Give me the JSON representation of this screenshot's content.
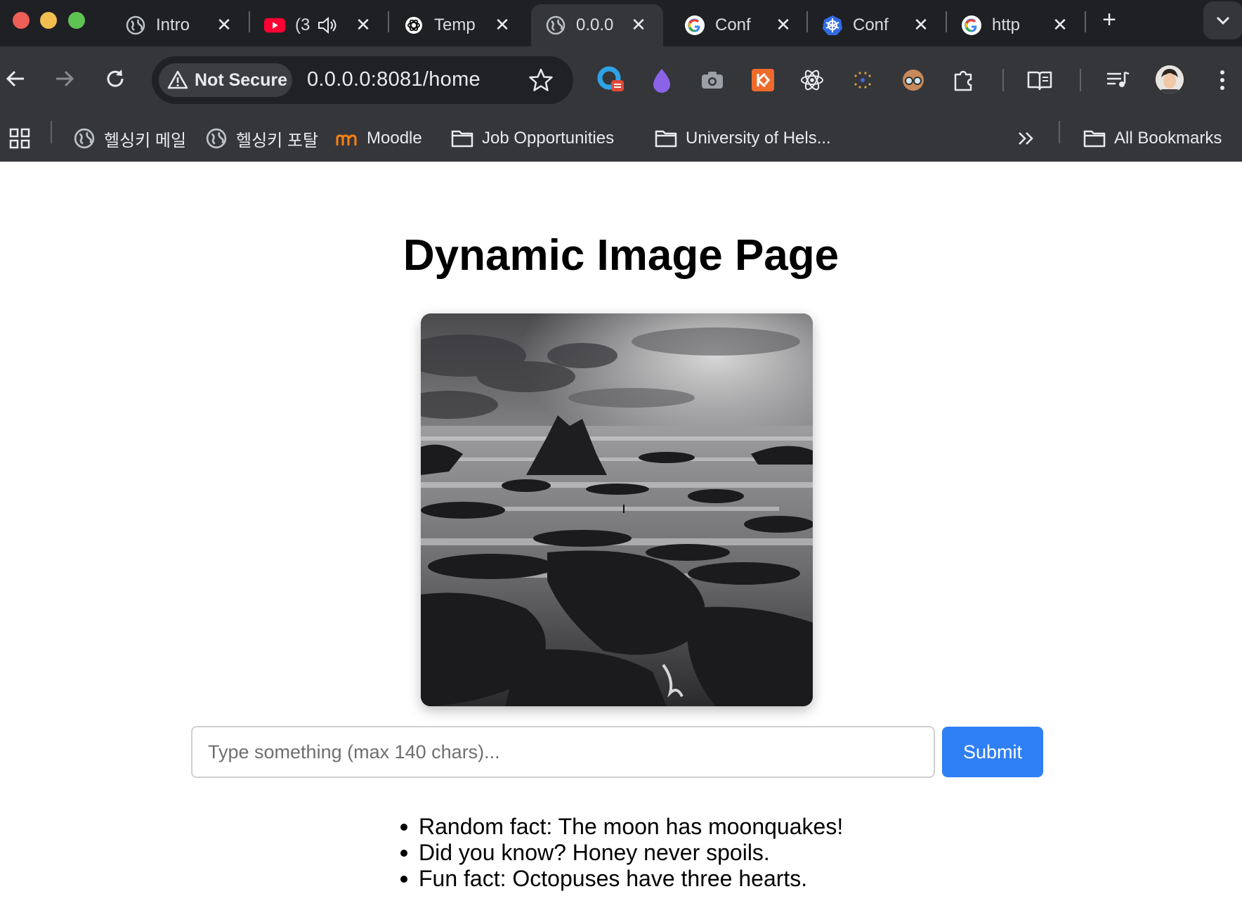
{
  "browser": {
    "tabs": [
      {
        "title": "Intro",
        "favicon": "globe-icon",
        "active": false
      },
      {
        "title": "(3",
        "favicon": "youtube-icon",
        "active": false,
        "audio": true
      },
      {
        "title": "Temp",
        "favicon": "openai-icon",
        "active": false
      },
      {
        "title": "0.0.0",
        "favicon": "globe-icon",
        "active": true
      },
      {
        "title": "Conf",
        "favicon": "google-icon",
        "active": false
      },
      {
        "title": "Conf",
        "favicon": "kubernetes-icon",
        "active": false
      },
      {
        "title": "http",
        "favicon": "google-icon",
        "active": false
      }
    ],
    "security_label": "Not Secure",
    "url": "0.0.0.0:8081/home",
    "bookmarks": [
      {
        "label": "헬싱키 메일",
        "icon": "globe-icon"
      },
      {
        "label": "헬싱키 포탈",
        "icon": "globe-icon"
      },
      {
        "label": "Moodle",
        "icon": "moodle-icon"
      },
      {
        "label": "Job Opportunities",
        "icon": "folder-icon"
      },
      {
        "label": "University of Hels...",
        "icon": "folder-icon"
      }
    ],
    "all_bookmarks_label": "All Bookmarks"
  },
  "page": {
    "title": "Dynamic Image Page",
    "input_placeholder": "Type something (max 140 chars)...",
    "input_value": "",
    "submit_label": "Submit",
    "facts": [
      "Random fact: The moon has moonquakes!",
      "Did you know? Honey never spoils.",
      "Fun fact: Octopuses have three hearts."
    ]
  },
  "colors": {
    "tabstrip_bg": "#1f2023",
    "toolbar_bg": "#35363a",
    "submit_bg": "#2f7ff5"
  }
}
